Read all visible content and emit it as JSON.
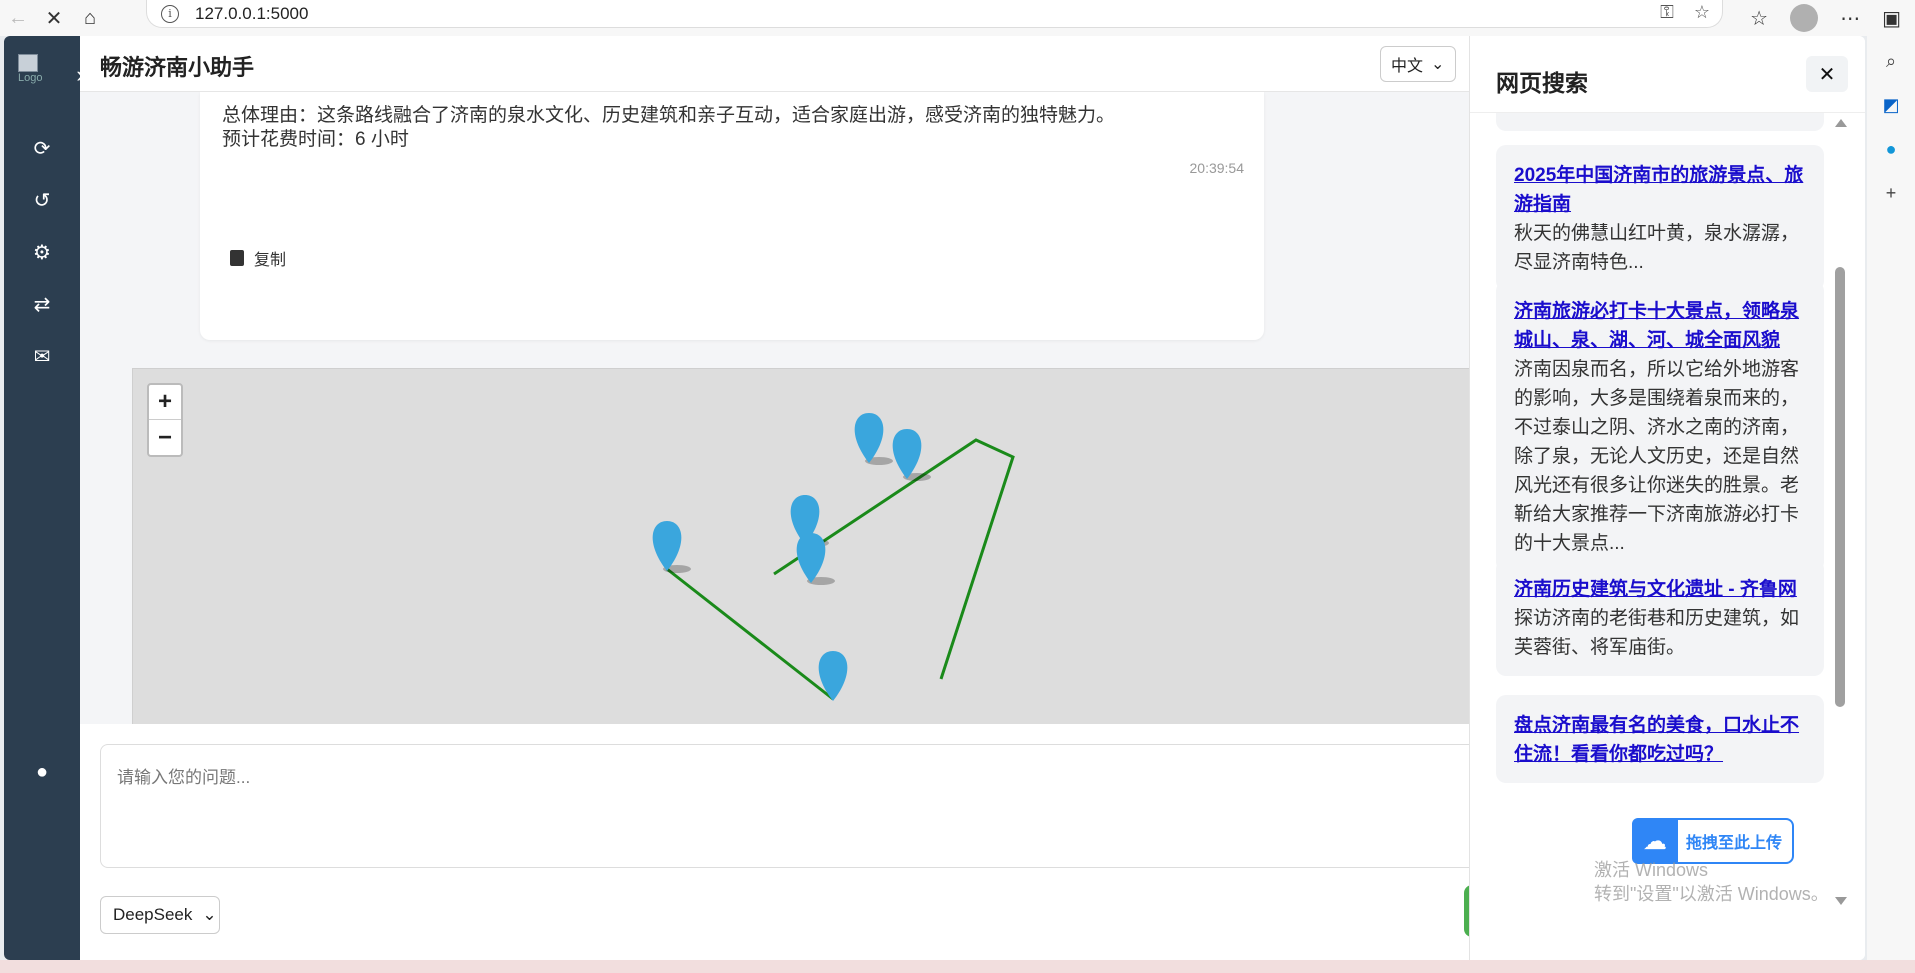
{
  "browser": {
    "url": "127.0.0.1:5000"
  },
  "app": {
    "title": "畅游济南小助手",
    "language": "中文",
    "logo_alt": "Logo"
  },
  "chat": {
    "reason_line": "总体理由：这条路线融合了济南的泉水文化、历史建筑和亲子互动，适合家庭出游，感受济南的独特魅力。",
    "time_line": "预计花费时间：6 小时",
    "timestamp": "20:39:54",
    "copy_label": "复制"
  },
  "map": {
    "zoom_in": "+",
    "zoom_out": "−",
    "route_color": "#1a8a1a",
    "marker_color": "#3aa6dd"
  },
  "input": {
    "placeholder": "请输入您的问题...",
    "model": "DeepSeek"
  },
  "panel": {
    "title": "网页搜索",
    "close": "✕",
    "results": [
      {
        "title": "2025年中国济南市的旅游景点、旅游指南",
        "snippet": "秋天的佛慧山红叶黄，泉水潺潺，尽显济南特色..."
      },
      {
        "title": "济南旅游必打卡十大景点，领略泉城山、泉、湖、河、城全面风貌",
        "snippet": "济南因泉而名，所以它给外地游客的影响，大多是围绕着泉而来的，不过泰山之阴、济水之南的济南，除了泉，无论人文历史，还是自然风光还有很多让你迷失的胜景。老靳给大家推荐一下济南旅游必打卡的十大景点..."
      },
      {
        "title": "济南历史建筑与文化遗址 - 齐鲁网",
        "snippet": "探访济南的老街巷和历史建筑，如芙蓉街、将军庙街。"
      },
      {
        "title": "盘点济南最有名的美食，口水止不住流！看看你都吃过吗？",
        "snippet": ""
      }
    ]
  },
  "upload": {
    "label": "拖拽至此上传"
  },
  "watermark": {
    "line1": "激活 Windows",
    "line2": "转到\"设置\"以激活 Windows。"
  }
}
